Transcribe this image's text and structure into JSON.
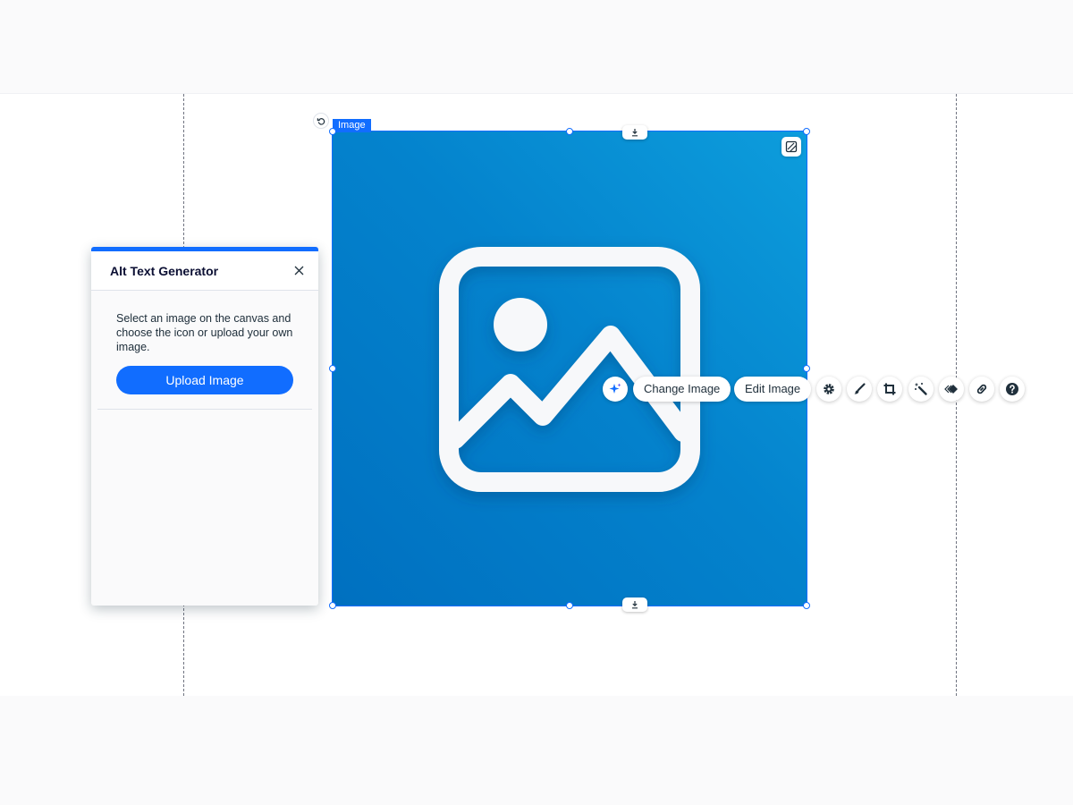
{
  "image_element": {
    "tag_label": "Image",
    "gradient_colors": [
      "#0d9ddc",
      "#0483cd",
      "#0070c0"
    ],
    "selection_color": "#116dff",
    "placeholder_icon": "image-placeholder-icon"
  },
  "toolbar": {
    "ai_icon": "sparkle-icon",
    "change_image_label": "Change Image",
    "edit_image_label": "Edit Image",
    "icons": [
      "gear-icon",
      "brush-icon",
      "crop-icon",
      "magic-wand-icon",
      "animation-icon",
      "link-icon",
      "help-icon"
    ]
  },
  "panel": {
    "accent_color": "#116dff",
    "title": "Alt Text Generator",
    "description": "Select an image on the canvas and choose the icon or upload your own image.",
    "upload_button_label": "Upload Image"
  }
}
